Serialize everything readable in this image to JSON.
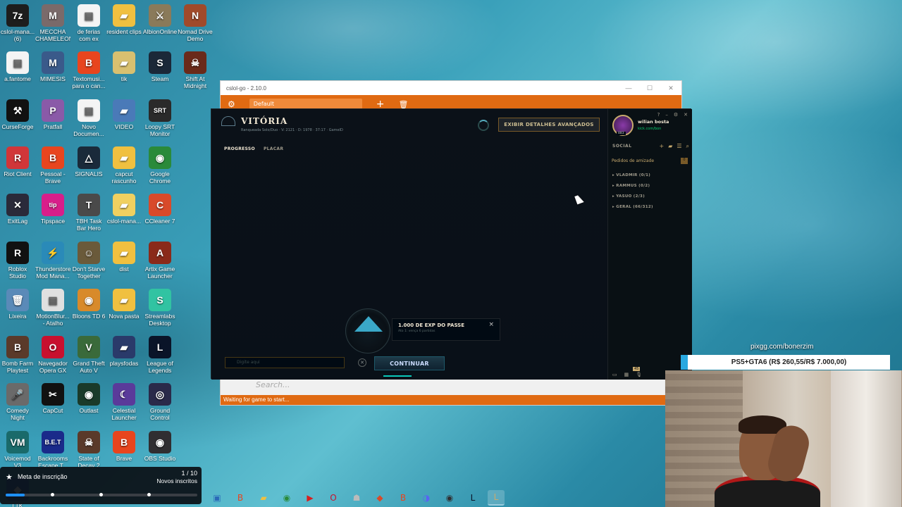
{
  "desktop": {
    "icons": [
      {
        "label": "cslol-mana... (6)",
        "glyph": "7z",
        "color": "#1d1d1d"
      },
      {
        "label": "MECCHA CHAMELEON",
        "glyph": "M",
        "color": "#7a6a6a"
      },
      {
        "label": "de ferias com ex",
        "glyph": "▤",
        "color": "#f4f4f4"
      },
      {
        "label": "resident clips",
        "glyph": "▰",
        "color": "#f0c040"
      },
      {
        "label": "AlbionOnline",
        "glyph": "⚔",
        "color": "#8a7a5a"
      },
      {
        "label": "Nomad Drive Demo",
        "glyph": "N",
        "color": "#a04a2a"
      },
      {
        "label": "a.fantome",
        "glyph": "▤",
        "color": "#f4f4f4"
      },
      {
        "label": "MIMESIS",
        "glyph": "M",
        "color": "#3a5a8a"
      },
      {
        "label": "Textomusi... para o can...",
        "glyph": "B",
        "color": "#e8451e"
      },
      {
        "label": "tik",
        "glyph": "▰",
        "color": "#d8c070"
      },
      {
        "label": "Steam",
        "glyph": "S",
        "color": "#1b2838"
      },
      {
        "label": "Shift At Midnight",
        "glyph": "☠",
        "color": "#6a2a1a"
      },
      {
        "label": "CurseForge",
        "glyph": "⚒",
        "color": "#111111"
      },
      {
        "label": "Pratfall",
        "glyph": "P",
        "color": "#8a5aa8"
      },
      {
        "label": "Novo Documen...",
        "glyph": "▤",
        "color": "#f4f4f4"
      },
      {
        "label": "VIDEO",
        "glyph": "▰",
        "color": "#4a7ab8"
      },
      {
        "label": "Loopy SRT Monitor",
        "glyph": "SRT",
        "color": "#2a2a2a"
      },
      {
        "label": "Riot Client",
        "glyph": "R",
        "color": "#d13639"
      },
      {
        "label": "Pessoal - Brave",
        "glyph": "B",
        "color": "#e8451e"
      },
      {
        "label": "SIGNALIS",
        "glyph": "△",
        "color": "#1a2a3a"
      },
      {
        "label": "capcut rascunho",
        "glyph": "▰",
        "color": "#f0c040"
      },
      {
        "label": "Google Chrome",
        "glyph": "◉",
        "color": "#2a8a3a"
      },
      {
        "label": "ExitLag",
        "glyph": "✕",
        "color": "#2a2a3a"
      },
      {
        "label": "Tipspace",
        "glyph": "tip",
        "color": "#d81e8a"
      },
      {
        "label": "TBH Task Bar Hero",
        "glyph": "T",
        "color": "#4a4a4a"
      },
      {
        "label": "cslol-mana...",
        "glyph": "▰",
        "color": "#f0d060"
      },
      {
        "label": "CCleaner 7",
        "glyph": "C",
        "color": "#d84a2a"
      },
      {
        "label": "Roblox Studio",
        "glyph": "R",
        "color": "#111111"
      },
      {
        "label": "Thunderstore Mod Mana...",
        "glyph": "⚡",
        "color": "#2a8ab8"
      },
      {
        "label": "Don't Starve Together",
        "glyph": "☺",
        "color": "#6a5a3a"
      },
      {
        "label": "dist",
        "glyph": "▰",
        "color": "#f0c040"
      },
      {
        "label": "Artix Game Launcher",
        "glyph": "A",
        "color": "#8a2a1a"
      },
      {
        "label": "Lixeira",
        "glyph": "🗑",
        "color": "#5a8ab8"
      },
      {
        "label": "MotionBlur... - Atalho",
        "glyph": "▤",
        "color": "#e0e0e0"
      },
      {
        "label": "Bloons TD 6",
        "glyph": "◉",
        "color": "#d88a2a"
      },
      {
        "label": "Nova pasta",
        "glyph": "▰",
        "color": "#f0c040"
      },
      {
        "label": "Streamlabs Desktop",
        "glyph": "S",
        "color": "#31c3a2"
      },
      {
        "label": "Bomb Farm Playtest",
        "glyph": "B",
        "color": "#5a3a2a"
      },
      {
        "label": "Navegador Opera GX",
        "glyph": "O",
        "color": "#c8102e"
      },
      {
        "label": "Grand Theft Auto V",
        "glyph": "V",
        "color": "#3a6a3a"
      },
      {
        "label": "playsfodas",
        "glyph": "▰",
        "color": "#2a3a6a"
      },
      {
        "label": "League of Legends",
        "glyph": "L",
        "color": "#0a1428"
      },
      {
        "label": "Comedy Night",
        "glyph": "🎤",
        "color": "#6a6a6a"
      },
      {
        "label": "CapCut",
        "glyph": "✂",
        "color": "#111111"
      },
      {
        "label": "Outlast",
        "glyph": "◉",
        "color": "#1a3a2a"
      },
      {
        "label": "Celestial Launcher",
        "glyph": "☾",
        "color": "#5a3a9a"
      },
      {
        "label": "Ground Control",
        "glyph": "◎",
        "color": "#2a2a4a"
      },
      {
        "label": "Voicemod V3",
        "glyph": "VM",
        "color": "#1a6a6a"
      },
      {
        "label": "Backrooms Escape T...",
        "glyph": "B.E.T",
        "color": "#1a2a8a"
      },
      {
        "label": "State of Decay 2",
        "glyph": "☠",
        "color": "#5a3a2a"
      },
      {
        "label": "Brave",
        "glyph": "B",
        "color": "#e8451e"
      },
      {
        "label": "OBS Studio",
        "glyph": "◉",
        "color": "#302e31"
      },
      {
        "label": "LTK Manager",
        "glyph": "◆",
        "color": "#2a6ab8"
      }
    ]
  },
  "cslol": {
    "title": "cslol-go - 2.10.0",
    "profile_dropdown": "Default",
    "search_placeholder": "Search...",
    "status": "Waiting for game to start..."
  },
  "lol": {
    "result": "VITÓRIA",
    "subtitle": "Ranqueada Solo/Duo  ·  V: 2121 · D: 1978  ·  37:17  ·  GameID",
    "adv_button": "EXIBIR DETALHES AVANÇADOS",
    "tabs": [
      {
        "label": "PROGRESSO"
      },
      {
        "label": "PLACAR"
      }
    ],
    "exp_title": "1.000 DE EXP DO PASSE",
    "exp_sub": "Ato 1: vença 6 partidas",
    "chat_placeholder": "Digite aqui",
    "continue_label": "CONTINUAR",
    "social": {
      "profile_name": "wilian bosta",
      "profile_status": "kick.com/bon",
      "profile_level": "883",
      "label": "SOCIAL",
      "friend_requests": "Pedidos de amizade",
      "friend_request_count": "0",
      "groups": [
        {
          "label": "VLADMIR (0/1)"
        },
        {
          "label": "RAMMUS (0/2)"
        },
        {
          "label": "YASUO (2/3)"
        },
        {
          "label": "GERAL (66/312)"
        }
      ],
      "footer_badge": "45"
    }
  },
  "stream": {
    "pix_url": "pixgg.com/bonerzim",
    "goal_text": "PS5+GTA6 (R$ 260,55/R$ 7.000,00)"
  },
  "notification": {
    "title": "Meta de inscrição",
    "count": "1 / 10",
    "sub": "Novos inscritos",
    "progress": 0.1
  },
  "taskbar": {
    "items": [
      {
        "name": "taskbar-item-explorer-app",
        "glyph": "▣",
        "color": "#2a6ab8"
      },
      {
        "name": "taskbar-item-brave",
        "glyph": "B",
        "color": "#e8451e"
      },
      {
        "name": "taskbar-item-file-explorer",
        "glyph": "▰",
        "color": "#f0c040"
      },
      {
        "name": "taskbar-item-chrome",
        "glyph": "◉",
        "color": "#2a8a3a"
      },
      {
        "name": "taskbar-item-youtube-app",
        "glyph": "▶",
        "color": "#d81e1e"
      },
      {
        "name": "taskbar-item-opera",
        "glyph": "O",
        "color": "#c8102e"
      },
      {
        "name": "taskbar-item-ghost-app",
        "glyph": "☗",
        "color": "#bbbbbb"
      },
      {
        "name": "taskbar-item-app-red",
        "glyph": "◆",
        "color": "#d84a2a"
      },
      {
        "name": "taskbar-item-brave-2",
        "glyph": "B",
        "color": "#e8451e"
      },
      {
        "name": "taskbar-item-discord",
        "glyph": "◑",
        "color": "#5865f2"
      },
      {
        "name": "taskbar-item-obs",
        "glyph": "◉",
        "color": "#302e31"
      },
      {
        "name": "taskbar-item-lol-client",
        "glyph": "L",
        "color": "#0a1428"
      },
      {
        "name": "taskbar-item-league",
        "glyph": "L",
        "color": "#c8aa6e"
      }
    ]
  }
}
